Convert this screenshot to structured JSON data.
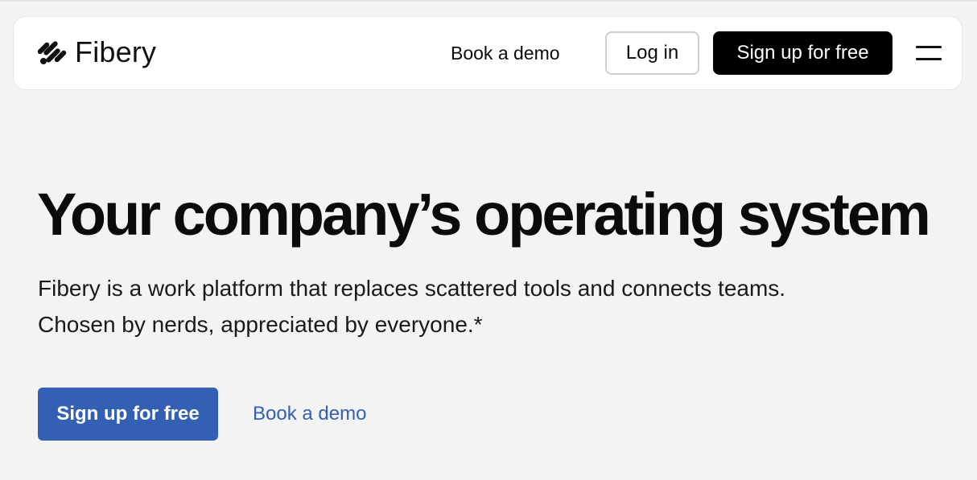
{
  "header": {
    "logo_text": "Fibery",
    "book_demo": "Book a demo",
    "login": "Log in",
    "signup": "Sign up for free"
  },
  "hero": {
    "title": "Your company’s operating system",
    "subtitle_line1": "Fibery is a work platform that replaces scattered tools and connects teams.",
    "subtitle_line2": "Chosen by nerds, appreciated by everyone.*",
    "cta_signup": "Sign up for free",
    "cta_demo": "Book a demo"
  },
  "colors": {
    "background": "#f3f3f3",
    "primary_blue": "#3460b3",
    "black": "#000000"
  },
  "icons": {
    "logo": "fibery-logo-icon",
    "menu": "hamburger-menu-icon"
  }
}
